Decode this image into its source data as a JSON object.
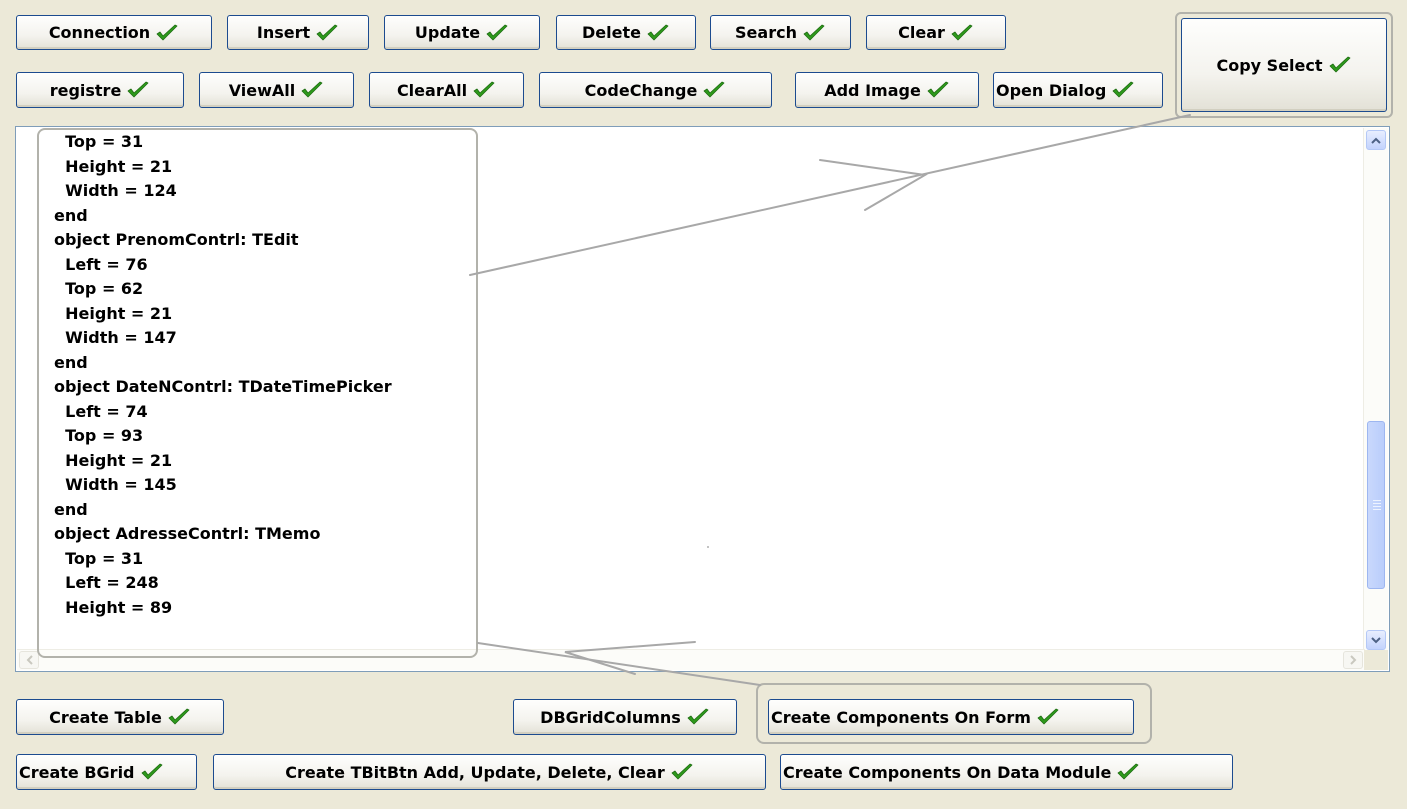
{
  "toolbar_row1": [
    {
      "label": "Connection"
    },
    {
      "label": "Insert"
    },
    {
      "label": "Update"
    },
    {
      "label": "Delete"
    },
    {
      "label": "Search"
    },
    {
      "label": "Clear"
    }
  ],
  "toolbar_row2": [
    {
      "label": "registre"
    },
    {
      "label": "ViewAll"
    },
    {
      "label": "ClearAll"
    },
    {
      "label": "CodeChange"
    },
    {
      "label": "Add Image"
    },
    {
      "label": "Open Dialog"
    }
  ],
  "copy_select": {
    "label": "Copy Select"
  },
  "memo": {
    "lines": [
      "  Top = 31",
      "  Height = 21",
      "  Width = 124",
      "end",
      "object PrenomContrl: TEdit",
      "  Left = 76",
      "  Top = 62",
      "  Height = 21",
      "  Width = 147",
      "end",
      "object DateNContrl: TDateTimePicker",
      "  Left = 74",
      "  Top = 93",
      "  Height = 21",
      "  Width = 145",
      "end",
      "object AdresseContrl: TMemo",
      "  Top = 31",
      "  Left = 248",
      "  Height = 89"
    ]
  },
  "bottom_row1": [
    {
      "label": "Create Table"
    },
    {
      "label": "DBGridColumns"
    },
    {
      "label": "Create Components On Form"
    }
  ],
  "bottom_row2": [
    {
      "label": "Create BGrid"
    },
    {
      "label": "Create TBitBtn Add, Update, Delete, Clear"
    },
    {
      "label": "Create Components On Data Module"
    }
  ],
  "icons": {
    "check": "check-icon",
    "scroll_up": "scroll-up-arrow-icon",
    "scroll_down": "scroll-down-arrow-icon",
    "scroll_left": "scroll-left-arrow-icon",
    "scroll_right": "scroll-right-arrow-icon",
    "annotation": "annotation-arrow-icon"
  },
  "colors": {
    "window_bg": "#ece9d8",
    "button_border": "#1c4b8f",
    "check_green": "#2e9a1c",
    "annotation_gray": "#a8a8a8"
  }
}
